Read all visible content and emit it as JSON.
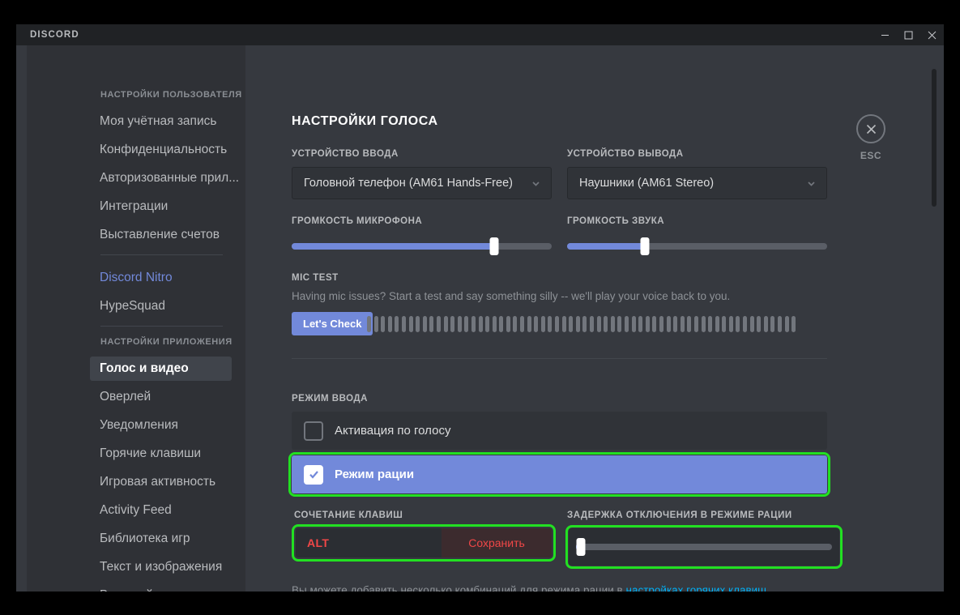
{
  "window": {
    "title": "DISCORD",
    "controls": [
      {
        "name": "minimize",
        "glyph": "minimize-icon"
      },
      {
        "name": "maximize",
        "glyph": "maximize-icon"
      },
      {
        "name": "close",
        "glyph": "close-icon"
      }
    ]
  },
  "sidebar": {
    "user_settings_header": "НАСТРОЙКИ ПОЛЬЗОВАТЕЛЯ",
    "user_items": [
      {
        "label": "Моя учётная запись",
        "active": false
      },
      {
        "label": "Конфиденциальность",
        "active": false
      },
      {
        "label": "Авторизованные прил...",
        "active": false
      },
      {
        "label": "Интеграции",
        "active": false
      },
      {
        "label": "Выставление счетов",
        "active": false
      }
    ],
    "promo_items": [
      {
        "label": "Discord Nitro",
        "accent": "#7289da"
      },
      {
        "label": "HypeSquad",
        "accent": ""
      }
    ],
    "app_settings_header": "НАСТРОЙКИ ПРИЛОЖЕНИЯ",
    "app_items": [
      {
        "label": "Голос и видео",
        "active": true
      },
      {
        "label": "Оверлей",
        "active": false
      },
      {
        "label": "Уведомления",
        "active": false
      },
      {
        "label": "Горячие клавиши",
        "active": false
      },
      {
        "label": "Игровая активность",
        "active": false
      },
      {
        "label": "Activity Feed",
        "active": false
      },
      {
        "label": "Библиотека игр",
        "active": false
      },
      {
        "label": "Текст и изображения",
        "active": false
      },
      {
        "label": "Внешний вид",
        "active": false
      }
    ]
  },
  "main": {
    "page_title": "НАСТРОЙКИ ГОЛОСА",
    "close": {
      "icon": "close-icon",
      "label": "ESC"
    },
    "input_device": {
      "label": "УСТРОЙСТВО ВВОДА",
      "value": "Головной телефон (AM61 Hands-Free)",
      "caret": "chevron-down-icon"
    },
    "output_device": {
      "label": "УСТРОЙСТВО ВЫВОДА",
      "value": "Наушники (AM61 Stereo)",
      "caret": "chevron-down-icon"
    },
    "mic_volume": {
      "label": "ГРОМКОСТЬ МИКРОФОНА",
      "percent": 78
    },
    "output_volume": {
      "label": "ГРОМКОСТЬ ЗВУКА",
      "percent": 30
    },
    "mic_test": {
      "label": "MIC TEST",
      "description": "Having mic issues? Start a test and say something silly -- we'll play your voice back to you.",
      "button": "Let's Check",
      "meter_bars": 62
    },
    "input_mode": {
      "label": "РЕЖИМ ВВОДА",
      "options": [
        {
          "label": "Активация по голосу",
          "selected": false
        },
        {
          "label": "Режим рации",
          "selected": true,
          "highlighted": true
        }
      ]
    },
    "keybind": {
      "label": "СОЧЕТАНИЕ КЛАВИШ",
      "value": "ALT",
      "save_label": "Сохранить",
      "highlighted": true
    },
    "ptt_delay": {
      "label": "ЗАДЕРЖКА ОТКЛЮЧЕНИЯ В РЕЖИМЕ РАЦИИ",
      "percent": 2,
      "highlighted": true
    },
    "hint": {
      "prefix": "Вы можете добавить несколько комбинаций для режима рации в ",
      "link": "настройках горячих клавиш",
      "suffix": "."
    }
  },
  "colors": {
    "accent": "#7289da",
    "annotation": "#22e022",
    "danger": "#f04747",
    "link": "#00aff4"
  }
}
